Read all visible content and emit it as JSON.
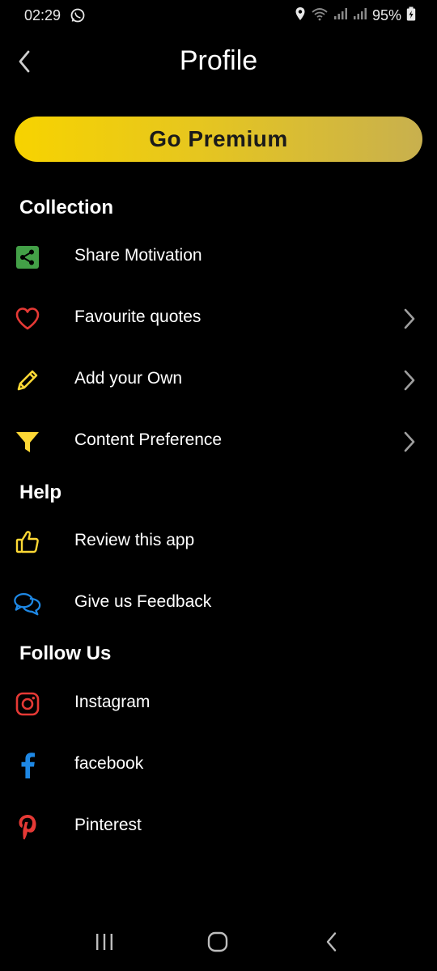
{
  "status_bar": {
    "time": "02:29",
    "battery": "95%"
  },
  "header": {
    "title": "Profile"
  },
  "premium": {
    "label": "Go Premium"
  },
  "sections": {
    "collection": {
      "title": "Collection",
      "items": [
        {
          "label": "Share Motivation",
          "icon": "share-icon"
        },
        {
          "label": "Favourite quotes",
          "icon": "heart-icon"
        },
        {
          "label": "Add your Own",
          "icon": "pencil-icon"
        },
        {
          "label": "Content Preference",
          "icon": "filter-icon"
        }
      ]
    },
    "help": {
      "title": "Help",
      "items": [
        {
          "label": "Review this app",
          "icon": "thumbs-up-icon"
        },
        {
          "label": "Give us Feedback",
          "icon": "chat-bubbles-icon"
        }
      ]
    },
    "follow": {
      "title": "Follow Us",
      "items": [
        {
          "label": "Instagram",
          "icon": "instagram-icon"
        },
        {
          "label": "facebook",
          "icon": "facebook-icon"
        },
        {
          "label": "Pinterest",
          "icon": "pinterest-icon"
        }
      ]
    }
  },
  "colors": {
    "background": "#000000",
    "premium_start": "#f7d300",
    "premium_end": "#c8b04e",
    "share_green": "#43a047",
    "heart_red": "#e53935",
    "pencil_yellow": "#fdd835",
    "filter_yellow": "#fdd835",
    "thumb_yellow": "#fdd835",
    "chat_blue": "#1e88e5",
    "instagram_red": "#e53935",
    "facebook_blue": "#1e88e5",
    "pinterest_red": "#e53935",
    "chevron_gray": "#9e9e9e"
  }
}
